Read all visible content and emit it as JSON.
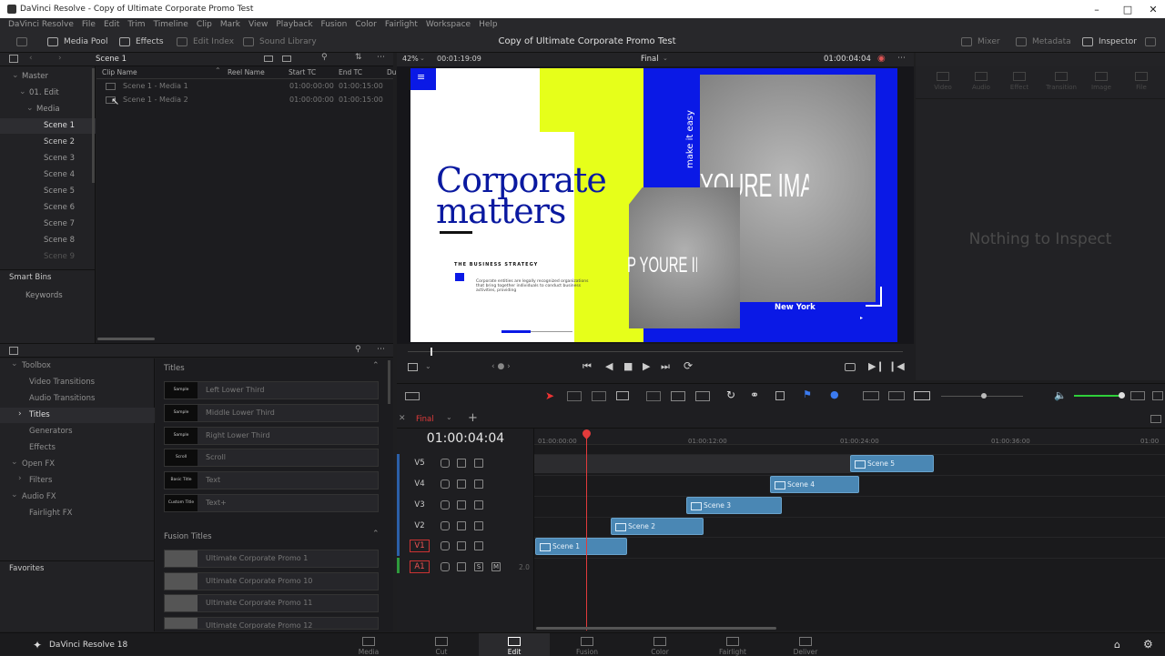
{
  "window": {
    "title": "DaVinci Resolve - Copy of Ultimate Corporate Promo Test"
  },
  "menu": [
    "DaVinci Resolve",
    "File",
    "Edit",
    "Trim",
    "Timeline",
    "Clip",
    "Mark",
    "View",
    "Playback",
    "Fusion",
    "Color",
    "Fairlight",
    "Workspace",
    "Help"
  ],
  "toolbar": {
    "media_pool": "Media Pool",
    "effects": "Effects",
    "edit_index": "Edit Index",
    "sound_library": "Sound Library",
    "project_title": "Copy of Ultimate Corporate Promo Test",
    "mixer": "Mixer",
    "metadata": "Metadata",
    "inspector": "Inspector"
  },
  "media_pool": {
    "current_bin": "Scene 1",
    "tree": [
      "Master",
      "01. Edit",
      "Media",
      "Scene 1",
      "Scene 2",
      "Scene 3",
      "Scene 4",
      "Scene 5",
      "Scene 6",
      "Scene 7",
      "Scene 8",
      "Scene 9"
    ],
    "smart_bins": "Smart Bins",
    "keywords": "Keywords",
    "columns": [
      "Clip Name",
      "Reel Name",
      "Start TC",
      "End TC",
      "Du"
    ],
    "clips": [
      {
        "name": "Scene 1 - Media 1",
        "start": "01:00:00:00",
        "end": "01:00:15:00"
      },
      {
        "name": "Scene 1 - Media 2",
        "start": "01:00:00:00",
        "end": "01:00:15:00"
      }
    ]
  },
  "effects": {
    "tree": [
      "Toolbox",
      "Video Transitions",
      "Audio Transitions",
      "Titles",
      "Generators",
      "Effects",
      "Open FX",
      "Filters",
      "Audio FX",
      "Fairlight FX"
    ],
    "favorites": "Favorites",
    "titles_header": "Titles",
    "titles": [
      {
        "thumb": "Sample",
        "name": "Left Lower Third"
      },
      {
        "thumb": "Sample",
        "name": "Middle Lower Third"
      },
      {
        "thumb": "Sample",
        "name": "Right Lower Third"
      },
      {
        "thumb": "Scroll",
        "name": "Scroll"
      },
      {
        "thumb": "Basic Title",
        "name": "Text"
      },
      {
        "thumb": "Custom Title",
        "name": "Text+"
      }
    ],
    "fusion_header": "Fusion Titles",
    "fusion_titles": [
      "Ultimate Corporate Promo 1",
      "Ultimate Corporate Promo 10",
      "Ultimate Corporate Promo 11",
      "Ultimate Corporate Promo 12"
    ]
  },
  "viewer": {
    "zoom": "42%",
    "duration": "00:01:19:09",
    "timeline_name": "Final",
    "timecode": "01:00:04:04",
    "frame": {
      "headline_1": "Corporate",
      "headline_2": "matters",
      "tagline": "THE BUSINESS STRATEGY",
      "body": "Corporate entities are legally recognized organizations that bring together individuals to conduct business activities, providing",
      "vertical": "make it easy",
      "placeholder_large": "YOURE IMAGE/VI",
      "placeholder_small": "P YOURE IMAGE/VI",
      "city": "New York"
    }
  },
  "inspector": {
    "tabs": [
      "Video",
      "Audio",
      "Effect",
      "Transition",
      "Image",
      "File"
    ],
    "empty": "Nothing to Inspect"
  },
  "timeline": {
    "tab": "Final",
    "timecode": "01:00:04:04",
    "ruler": [
      "01:00:00:00",
      "01:00:12:00",
      "01:00:24:00",
      "01:00:36:00",
      "01:00"
    ],
    "tracks": [
      "V5",
      "V4",
      "V3",
      "V2",
      "V1",
      "A1"
    ],
    "audio_level": "2.0",
    "clips": [
      "Scene 5",
      "Scene 4",
      "Scene 3",
      "Scene 2",
      "Scene 1"
    ],
    "solo": "S",
    "mute": "M"
  },
  "pages": [
    "Media",
    "Cut",
    "Edit",
    "Fusion",
    "Color",
    "Fairlight",
    "Deliver"
  ],
  "brand": "DaVinci Resolve 18",
  "colors": {
    "accent_blue": "#0a19e6",
    "lime": "#e6ff1a",
    "clip_blue": "#4a87b4",
    "playhead": "#e23b3b"
  }
}
